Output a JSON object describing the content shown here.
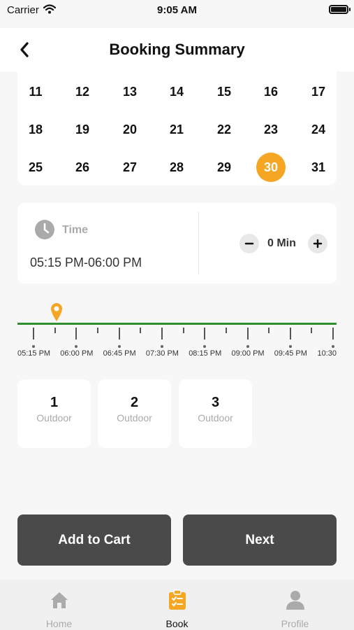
{
  "status_bar": {
    "carrier": "Carrier",
    "time": "9:05 AM"
  },
  "header": {
    "title": "Booking Summary"
  },
  "calendar": {
    "rows": [
      [
        "11",
        "12",
        "13",
        "14",
        "15",
        "16",
        "17"
      ],
      [
        "18",
        "19",
        "20",
        "21",
        "22",
        "23",
        "24"
      ],
      [
        "25",
        "26",
        "27",
        "28",
        "29",
        "30",
        "31"
      ]
    ],
    "selected_day": "30"
  },
  "time": {
    "label": "Time",
    "range": "05:15 PM-06:00 PM",
    "duration": "0 Min"
  },
  "timeline": {
    "labels": [
      "05:15 PM",
      "06:00 PM",
      "06:45 PM",
      "07:30 PM",
      "08:15 PM",
      "09:00 PM",
      "09:45 PM",
      "10:30"
    ]
  },
  "tables": [
    {
      "number": "1",
      "type": "Outdoor"
    },
    {
      "number": "2",
      "type": "Outdoor"
    },
    {
      "number": "3",
      "type": "Outdoor"
    }
  ],
  "actions": {
    "add_to_cart": "Add to Cart",
    "next": "Next"
  },
  "tab_bar": {
    "items": [
      {
        "label": "Home",
        "icon": "home-icon"
      },
      {
        "label": "Book",
        "icon": "clipboard-icon"
      },
      {
        "label": "Profile",
        "icon": "person-icon"
      }
    ],
    "active": "Book"
  },
  "colors": {
    "accent": "#f5a623",
    "timeline": "#2f8f2f",
    "button": "#4a4a4a"
  }
}
